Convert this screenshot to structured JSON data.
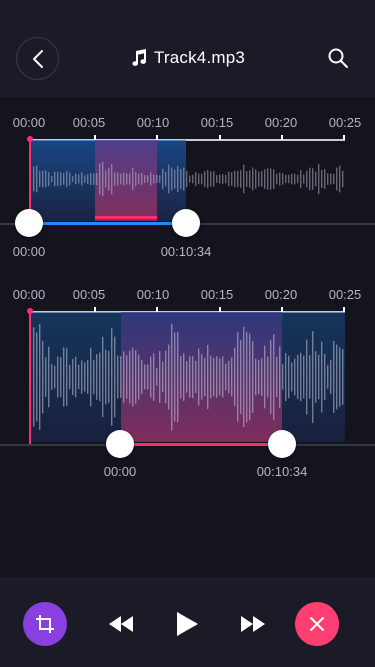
{
  "header": {
    "title": "Track4.mp3",
    "back_icon": "chevron-left-icon",
    "music_icon": "music-note-icon",
    "search_icon": "search-icon"
  },
  "timeline_ticks": [
    "00:00",
    "00:05",
    "00:10",
    "00:15",
    "00:20",
    "00:25"
  ],
  "editor1": {
    "start_label": "00:00",
    "end_label": "00:10:34"
  },
  "editor2": {
    "start_label": "00:00",
    "end_label": "00:10:34"
  },
  "footer": {
    "crop_icon": "crop-icon",
    "rewind_icon": "rewind-icon",
    "play_icon": "play-icon",
    "forward_icon": "fast-forward-icon",
    "close_icon": "close-icon"
  },
  "colors": {
    "accent_pink": "#ff2d6f",
    "accent_blue": "#1e8bff",
    "accent_purple": "#8a40e0",
    "background": "#14141f",
    "panel": "#1a1b27"
  }
}
